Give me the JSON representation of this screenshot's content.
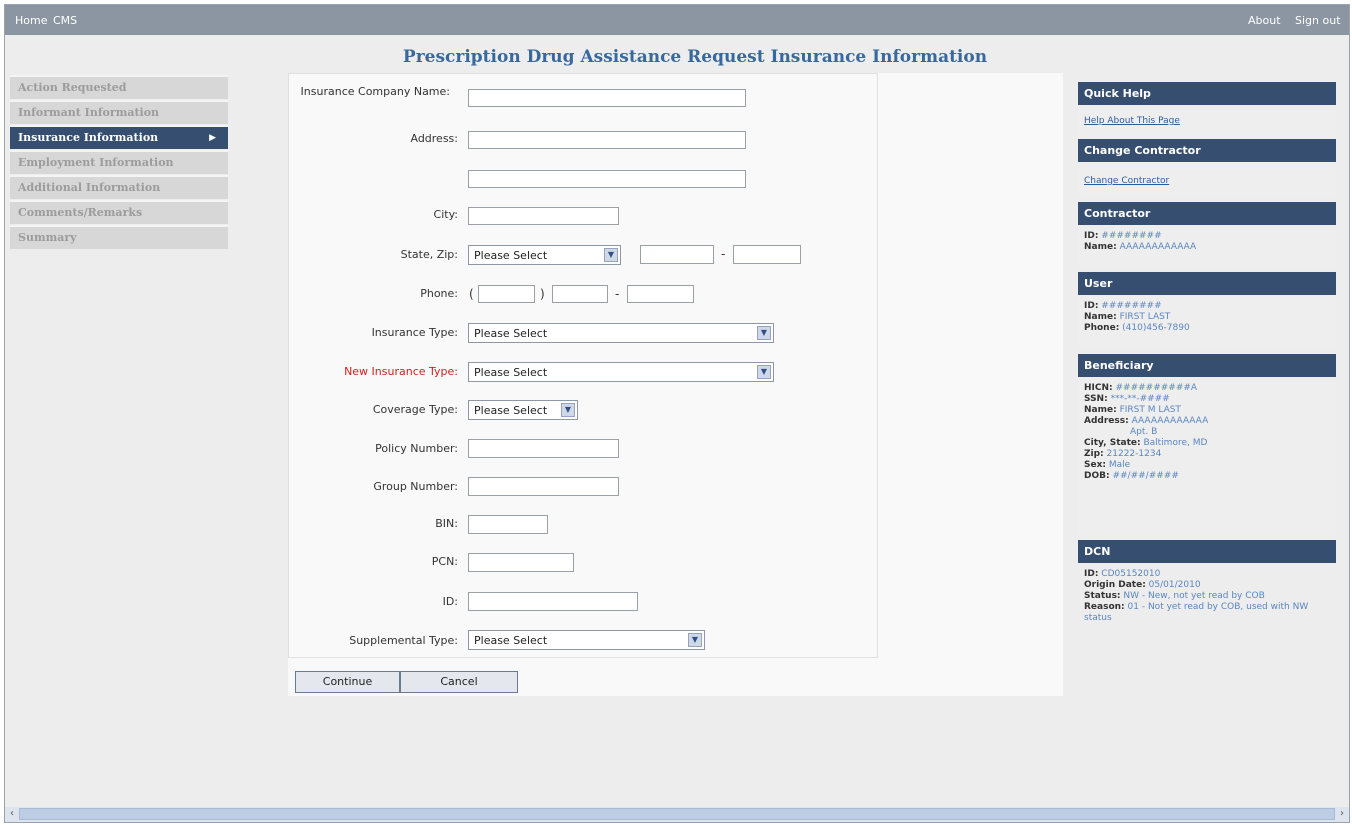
{
  "topbar": {
    "home": "Home",
    "cms": "CMS",
    "about": "About",
    "signout": "Sign out"
  },
  "page_title": "Prescription Drug Assistance Request Insurance Information",
  "nav": [
    {
      "label": "Action Requested",
      "active": false
    },
    {
      "label": "Informant Information",
      "active": false
    },
    {
      "label": "Insurance Information",
      "active": true
    },
    {
      "label": "Employment Information",
      "active": false
    },
    {
      "label": "Additional Information",
      "active": false
    },
    {
      "label": "Comments/Remarks",
      "active": false
    },
    {
      "label": "Summary",
      "active": false
    }
  ],
  "form": {
    "insurance_company_name_label": "Insurance Company Name:",
    "address_label": "Address:",
    "city_label": "City:",
    "state_zip_label": "State, Zip:",
    "state_select": "Please Select",
    "zip_sep": "-",
    "phone_label": "Phone:",
    "phone_open": "(",
    "phone_close": ")",
    "phone_sep": "-",
    "insurance_type_label": "Insurance Type:",
    "insurance_type_select": "Please Select",
    "new_insurance_type_label": "New Insurance Type:",
    "new_insurance_type_select": "Please Select",
    "coverage_type_label": "Coverage Type:",
    "coverage_type_select": "Please Select",
    "policy_number_label": "Policy Number:",
    "group_number_label": "Group Number:",
    "bin_label": "BIN:",
    "pcn_label": "PCN:",
    "id_label": "ID:",
    "supplemental_type_label": "Supplemental Type:",
    "supplemental_type_select": "Please Select"
  },
  "buttons": {
    "continue": "Continue",
    "cancel": "Cancel"
  },
  "sidebar": {
    "quick_help": {
      "title": "Quick Help",
      "link": "Help About This Page"
    },
    "change_contractor": {
      "title": "Change Contractor",
      "link": "Change Contractor"
    },
    "contractor": {
      "title": "Contractor",
      "id_key": "ID:",
      "id_val": "########",
      "name_key": "Name:",
      "name_val": "AAAAAAAAAAAA"
    },
    "user": {
      "title": "User",
      "id_key": "ID:",
      "id_val": "########",
      "name_key": "Name:",
      "name_val": "FIRST LAST",
      "phone_key": "Phone:",
      "phone_val": "(410)456-7890"
    },
    "beneficiary": {
      "title": "Beneficiary",
      "hicn_key": "HICN:",
      "hicn_val": "##########A",
      "ssn_key": "SSN:",
      "ssn_val": "***-**-####",
      "name_key": "Name:",
      "name_val": "FIRST M LAST",
      "address_key": "Address:",
      "address_val": "AAAAAAAAAAAA",
      "address_val2": "Apt. B",
      "citystate_key": "City, State:",
      "citystate_val": "Baltimore, MD",
      "zip_key": "Zip:",
      "zip_val": "21222-1234",
      "sex_key": "Sex:",
      "sex_val": "Male",
      "dob_key": "DOB:",
      "dob_val": "##/##/####"
    },
    "dcn": {
      "title": "DCN",
      "id_key": "ID:",
      "id_val": "CD05152010",
      "origin_key": "Origin Date:",
      "origin_val": "05/01/2010",
      "status_key": "Status:",
      "status_val": "NW - New, not yet read by COB",
      "reason_key": "Reason:",
      "reason_val": "01 - Not yet read by COB, used with NW status"
    }
  },
  "scrollbar": {
    "left_arrow": "‹",
    "right_arrow": "›"
  }
}
